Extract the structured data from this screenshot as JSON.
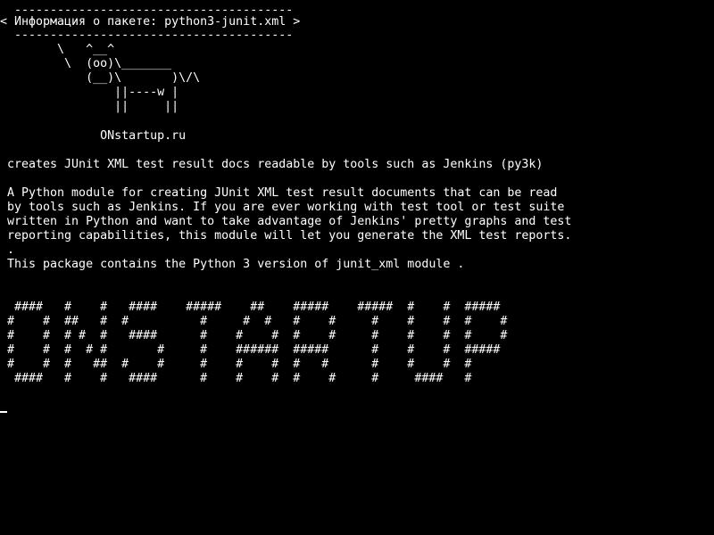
{
  "colors": {
    "background": "#000000",
    "foreground": "#ffffff"
  },
  "banner": {
    "top_rule": "  ---------------------------------------",
    "title": "< Информация о пакете: python3-junit.xml >",
    "bottom_rule": "  ---------------------------------------",
    "cow_art": "        \\   ^__^\n         \\  (oo)\\_______\n            (__)\\       )\\/\\\n                ||----w |\n                ||     ||",
    "site": "              ONstartup.ru"
  },
  "package": {
    "summary": " creates JUnit XML test result docs readable by tools such as Jenkins (py3k)",
    "description": " A Python module for creating JUnit XML test result documents that can be read\n by tools such as Jenkins. If you are ever working with test tool or test suite\n written in Python and want to take advantage of Jenkins' pretty graphs and test\n reporting capabilities, this module will let you generate the XML test reports.\n .\n This package contains the Python 3 version of junit_xml module ."
  },
  "ascii_banner": "  ####   #    #   ####    #####    ##    #####    #####  #    #  #####\n #    #  ##   #  #          #     #  #   #    #     #    #    #  #    #\n #    #  # #  #   ####      #    #    #  #    #     #    #    #  #    #\n #    #  #  # #       #     #    ######  #####      #    #    #  #####\n #    #  #   ##  #    #     #    #    #  #   #      #    #    #  #\n  ####   #    #   ####      #    #    #  #    #     #     ####   #"
}
